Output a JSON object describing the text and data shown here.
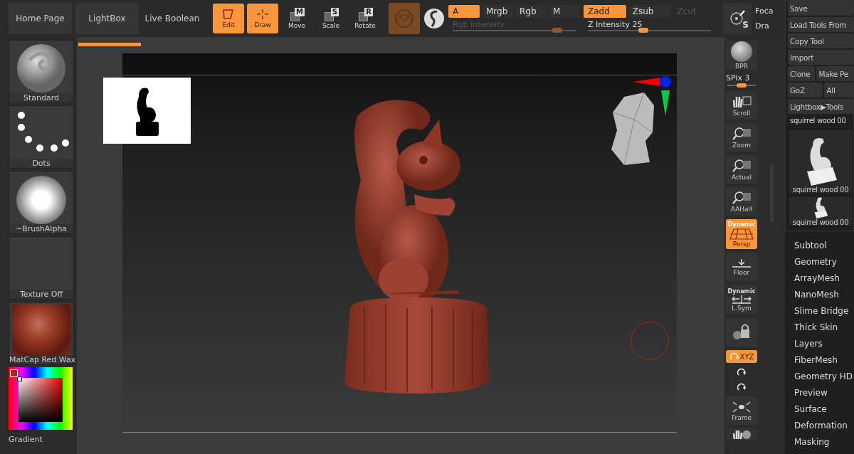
{
  "top_toolbar": {
    "nav_buttons": [
      "Home Page",
      "LightBox",
      "Live Boolean"
    ],
    "tools": [
      {
        "kind": "edit",
        "label": "Edit",
        "selected": true
      },
      {
        "kind": "draw",
        "label": "Draw",
        "selected": true
      },
      {
        "kind": "move",
        "label": "Move",
        "key": "M",
        "selected": false
      },
      {
        "kind": "scale",
        "label": "Scale",
        "key": "S",
        "selected": false
      },
      {
        "kind": "rotate",
        "label": "Rotate",
        "key": "R",
        "selected": false
      }
    ],
    "rgb_modes": [
      {
        "label": "A",
        "selected": true
      },
      {
        "label": "Mrgb",
        "selected": false
      },
      {
        "label": "Rgb",
        "selected": false
      },
      {
        "label": "M",
        "selected": false
      }
    ],
    "rgb_intensity": {
      "label": "Rgb Intensity",
      "level": 0.85,
      "disabled": true
    },
    "z_modes": [
      {
        "label": "Zadd",
        "selected": true,
        "disabled": false
      },
      {
        "label": "Zsub",
        "selected": false,
        "disabled": false
      },
      {
        "label": "Zcut",
        "selected": false,
        "disabled": true
      }
    ],
    "z_intensity": {
      "label": "Z Intensity 25",
      "level": 0.45,
      "disabled": false
    },
    "symmetry_key": "S",
    "cut_labels": [
      "Foca",
      "Dra"
    ]
  },
  "left_panel": [
    {
      "kind": "brush",
      "label": "Standard"
    },
    {
      "kind": "stroke",
      "label": "Dots"
    },
    {
      "kind": "alpha",
      "label": "~BrushAlpha"
    },
    {
      "kind": "texture",
      "label": "Texture Off"
    },
    {
      "kind": "material",
      "label": "MatCap Red Wax"
    },
    {
      "kind": "color",
      "label": "Gradient"
    }
  ],
  "view_tools": [
    {
      "kind": "bpr",
      "label": "BPR",
      "selected": false
    },
    {
      "kind": "slider",
      "label": "SPix 3",
      "level": 0.5
    },
    {
      "kind": "scroll",
      "label": "Scroll",
      "selected": false
    },
    {
      "kind": "zoom",
      "label": "Zoom",
      "selected": false
    },
    {
      "kind": "actual",
      "label": "Actual",
      "selected": false
    },
    {
      "kind": "aahalf",
      "label": "AAHalf",
      "selected": false
    },
    {
      "kind": "persp",
      "label": "Persp",
      "caption": "Dynamic",
      "selected": true
    },
    {
      "kind": "floor",
      "label": "Floor",
      "selected": false
    },
    {
      "kind": "lsym",
      "label": "L.Sym",
      "caption": "Dynamic",
      "selected": false
    },
    {
      "kind": "lock",
      "selected": false
    },
    {
      "kind": "xyz",
      "label": "XYZ",
      "selected": true
    },
    {
      "kind": "roty",
      "selected": false
    },
    {
      "kind": "rotz",
      "selected": false
    },
    {
      "kind": "frame",
      "label": "Frame",
      "selected": false
    },
    {
      "kind": "move",
      "selected": false
    }
  ],
  "tool_panel": {
    "button_rows": [
      [
        "Save"
      ],
      [
        "Load Tools From"
      ],
      [
        "Copy Tool"
      ],
      [
        "Import"
      ],
      [
        "Clone",
        "Make Pe"
      ],
      [
        "GoZ",
        "All"
      ],
      [
        "Lightbox▶Tools"
      ]
    ],
    "current_tool": "squirrel wood 00",
    "thumbnails": [
      {
        "label": "squirrel wood 00",
        "kind": "large"
      },
      {
        "label": "squirrel wood 00",
        "kind": "small"
      }
    ],
    "menu": [
      "Subtool",
      "Geometry",
      "ArrayMesh",
      "NanoMesh",
      "Slime Bridge",
      "Thick Skin",
      "Layers",
      "FiberMesh",
      "Geometry HD",
      "Preview",
      "Surface",
      "Deformation",
      "Masking"
    ]
  }
}
